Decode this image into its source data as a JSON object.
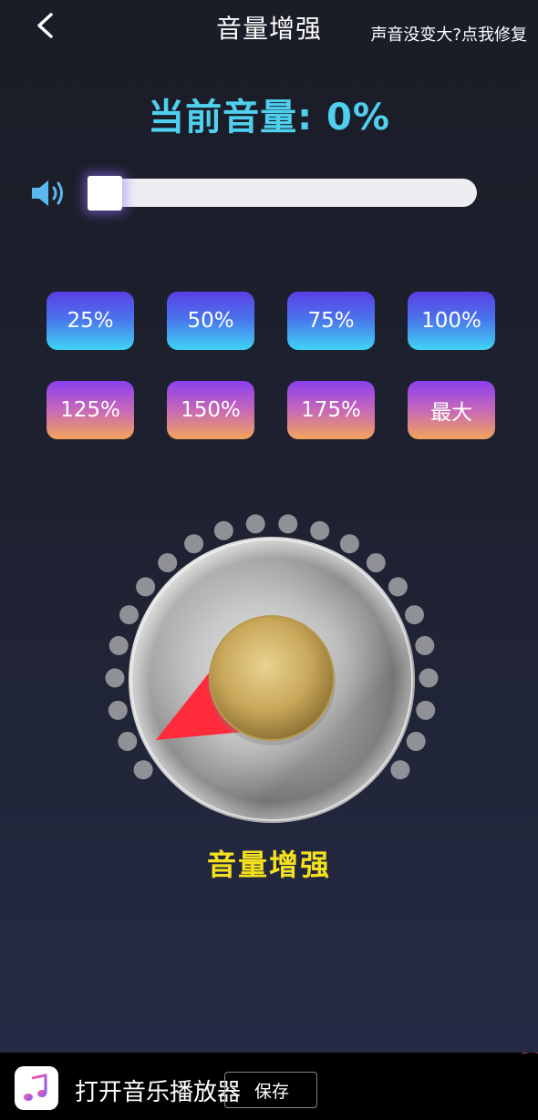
{
  "header": {
    "title": "音量增强",
    "help_link": "声音没变大?点我修复"
  },
  "volume": {
    "label": "当前音量: 0%",
    "level": 0
  },
  "presets": {
    "row1": [
      "25%",
      "50%",
      "75%",
      "100%"
    ],
    "row2": [
      "125%",
      "150%",
      "175%",
      "最大"
    ]
  },
  "knob": {
    "label": "音量增强",
    "active_dots": 0,
    "total_dots": 22
  },
  "ad_banner": {
    "app_text": "打开音乐播放器",
    "save_button": "保存"
  },
  "colors": {
    "accent_cyan": "#4fd0ee",
    "knob_label": "#f4e11e",
    "pointer_red": "#ff2a3a",
    "dot_inactive": "#8f9196"
  }
}
